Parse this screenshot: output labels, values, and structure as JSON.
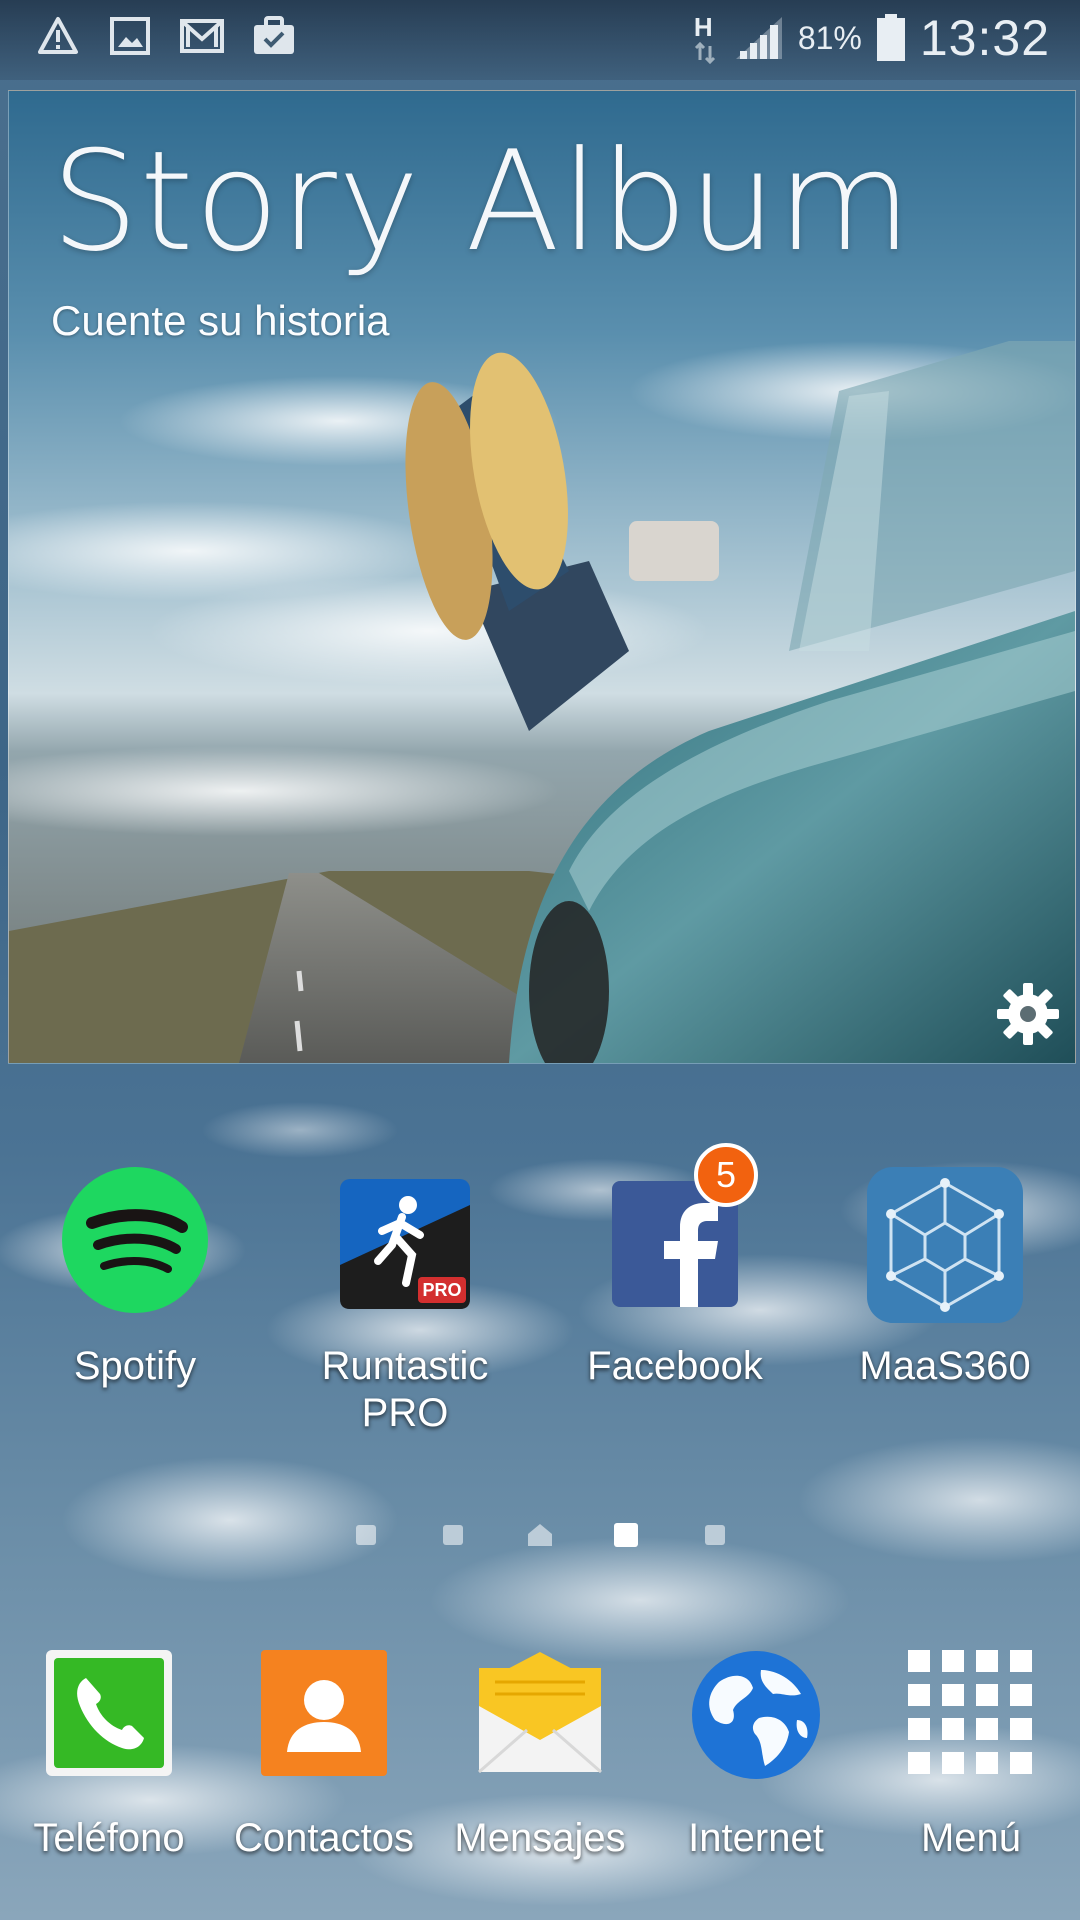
{
  "status_bar": {
    "left_icons": [
      "warning-icon",
      "gallery-icon",
      "gmail-icon",
      "briefcase-icon"
    ],
    "network_type": "H",
    "battery_percent": "81%",
    "battery_level": 0.81,
    "time": "13:32"
  },
  "widget": {
    "title": "Story Album",
    "subtitle": "Cuente su historia",
    "settings_icon": "gear-icon"
  },
  "apps": [
    {
      "label": "Spotify",
      "icon": "spotify-icon",
      "color": "#1ed760"
    },
    {
      "label": "Runtastic PRO",
      "icon": "runtastic-icon",
      "color": "#1565c0",
      "icon_tag": "PRO"
    },
    {
      "label": "Facebook",
      "icon": "facebook-icon",
      "color": "#3b5998",
      "badge": "5"
    },
    {
      "label": "MaaS360",
      "icon": "maas360-icon",
      "color": "#3b7fb6"
    }
  ],
  "pager": {
    "pages": 5,
    "home_index": 2,
    "active_index": 3
  },
  "dock": [
    {
      "label": "Teléfono",
      "icon": "phone-icon",
      "color": "#35b925"
    },
    {
      "label": "Contactos",
      "icon": "contacts-icon",
      "color": "#f5821f"
    },
    {
      "label": "Mensajes",
      "icon": "messages-icon",
      "color": "#f9c623"
    },
    {
      "label": "Internet",
      "icon": "internet-icon",
      "color": "#1e73d6"
    },
    {
      "label": "Menú",
      "icon": "apps-grid-icon",
      "color": "#ffffff"
    }
  ]
}
